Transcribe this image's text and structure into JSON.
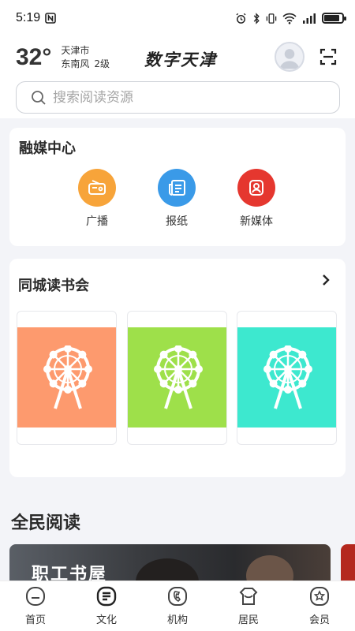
{
  "status_bar": {
    "time": "5:19"
  },
  "header": {
    "temperature": "32°",
    "city": "天津市",
    "wind_direction": "东南风",
    "wind_level": "2级",
    "logo_text": "数字天津"
  },
  "search": {
    "placeholder": "搜索阅读资源"
  },
  "media_center": {
    "title": "融媒中心",
    "items": [
      {
        "label": "广播",
        "icon": "radio-icon",
        "color": "#f7a43a"
      },
      {
        "label": "报纸",
        "icon": "newspaper-icon",
        "color": "#3a9ae8"
      },
      {
        "label": "新媒体",
        "icon": "new-media-icon",
        "color": "#e5372f"
      }
    ]
  },
  "book_club": {
    "title": "同城读书会",
    "covers": [
      {
        "color": "#fd9a6e",
        "icon": "ferris-wheel-icon"
      },
      {
        "color": "#9ee04a",
        "icon": "ferris-wheel-icon"
      },
      {
        "color": "#3de8cf",
        "icon": "ferris-wheel-icon"
      }
    ]
  },
  "reading": {
    "title": "全民阅读",
    "banner_text": "职工书屋"
  },
  "tabs": [
    {
      "label": "首页",
      "icon": "home-icon"
    },
    {
      "label": "文化",
      "icon": "culture-icon"
    },
    {
      "label": "机构",
      "icon": "institution-icon"
    },
    {
      "label": "居民",
      "icon": "resident-icon"
    },
    {
      "label": "会员",
      "icon": "member-icon"
    }
  ]
}
